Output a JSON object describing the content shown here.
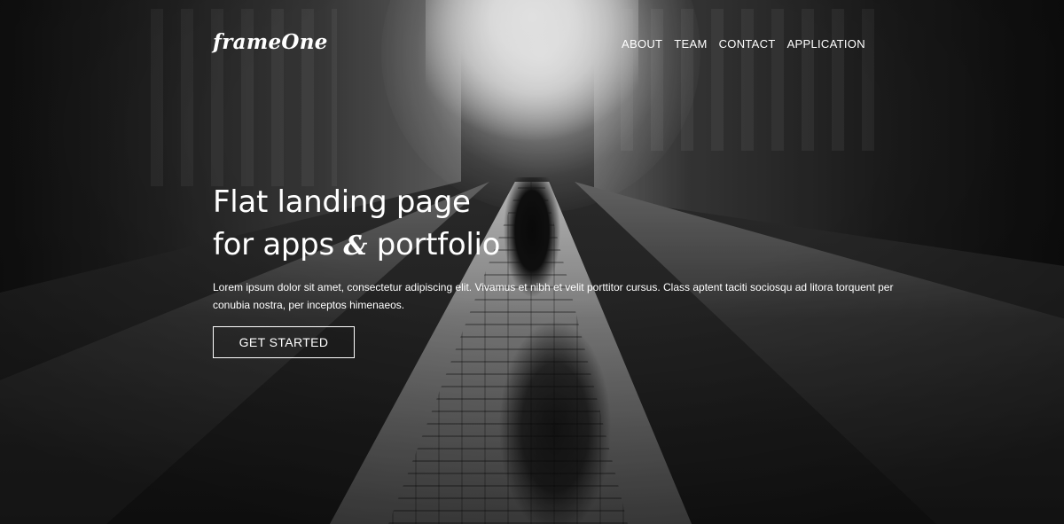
{
  "navbar": {
    "logo": "frameOne",
    "links": [
      {
        "label": "ABOUT"
      },
      {
        "label": "TEAM"
      },
      {
        "label": "CONTACT"
      },
      {
        "label": "APPLICATION"
      }
    ]
  },
  "hero": {
    "title_line1": "Flat landing page",
    "title_line2_pre": "for apps ",
    "title_line2_amp": "&",
    "title_line2_post": " portfolio",
    "text": "Lorem ipsum dolor sit amet, consectetur adipiscing elit. Vivamus et nibh et velit porttitor cursus. Class aptent taciti sociosqu ad litora torquent per conubia nostra, per inceptos himenaeos.",
    "cta_label": "GET STARTED"
  },
  "colors": {
    "text": "#ffffff",
    "button_border": "#ffffff"
  }
}
